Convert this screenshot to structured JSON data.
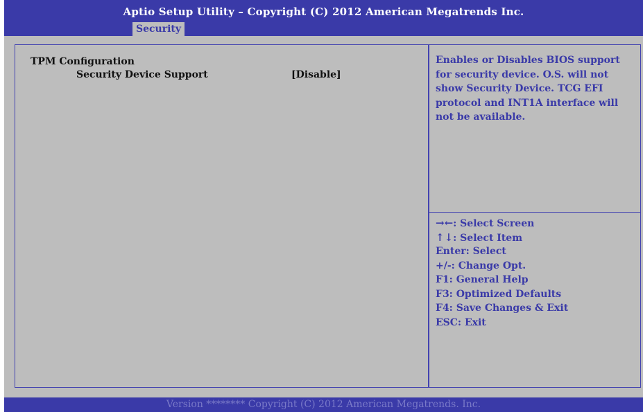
{
  "header": {
    "title": "Aptio Setup Utility – Copyright (C) 2012 American Megatrends Inc.",
    "tab_label": "Security"
  },
  "main": {
    "section_title": "TPM Configuration",
    "option": {
      "label": "Security Device Support",
      "value": "[Disable]"
    }
  },
  "help": {
    "text": "Enables or Disables BIOS support for security device. O.S. will not show Security Device. TCG EFI protocol and INT1A interface will not be available."
  },
  "keys": [
    {
      "icon": "→←",
      "icon_name": "left-right-arrows-icon",
      "text": ": Select Screen"
    },
    {
      "icon": "↑↓",
      "icon_name": "up-down-arrows-icon",
      "text": ": Select Item"
    },
    {
      "text": "Enter: Select"
    },
    {
      "text": "+/-: Change Opt."
    },
    {
      "text": "F1: General Help"
    },
    {
      "text": "F3: Optimized Defaults"
    },
    {
      "text": "F4: Save Changes & Exit"
    },
    {
      "text": "ESC: Exit"
    }
  ],
  "footer": {
    "text": "Version ******** Copyright (C) 2012 American Megatrends. Inc."
  },
  "colors": {
    "header_bg": "#3a3aa8",
    "panel_bg": "#bdbdbd",
    "help_text": "#3a3aa8",
    "footer_text": "#7a7ac8"
  }
}
